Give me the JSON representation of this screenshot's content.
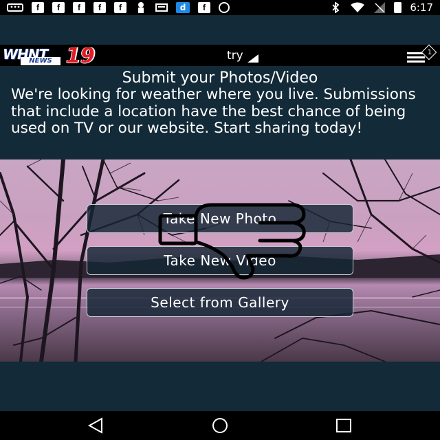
{
  "status_bar": {
    "time": "6:17",
    "icons_left": [
      "message-icon",
      "facebook-icon",
      "facebook-icon",
      "facebook-icon",
      "facebook-icon",
      "facebook-icon",
      "notification-icon",
      "email-icon",
      "download-icon",
      "facebook-icon",
      "circle-icon"
    ],
    "icons_right": [
      "bluetooth-icon",
      "wifi-icon",
      "signal-icon",
      "battery-icon"
    ],
    "fb_glyph": "f",
    "dl_glyph": "d",
    "msg_glyph": "•••"
  },
  "app_bar": {
    "logo_word": "WHNT",
    "logo_news": "NEWS",
    "logo_number": "19",
    "title": "try",
    "menu_badge": "1"
  },
  "content": {
    "title": "Submit your Photos/Video",
    "description": "We're looking for weather where you live. Submissions that include a location have the best chance of being used on TV or our website. Start sharing today!"
  },
  "buttons": {
    "take_photo": "Take New Photo",
    "take_video": "Take New Video",
    "gallery": "Select from Gallery"
  },
  "colors": {
    "background": "#132a38",
    "bar": "#000000",
    "logo_red": "#e31b23",
    "logo_blue": "#1a3a8f",
    "button_border": "#c9cdd3"
  }
}
